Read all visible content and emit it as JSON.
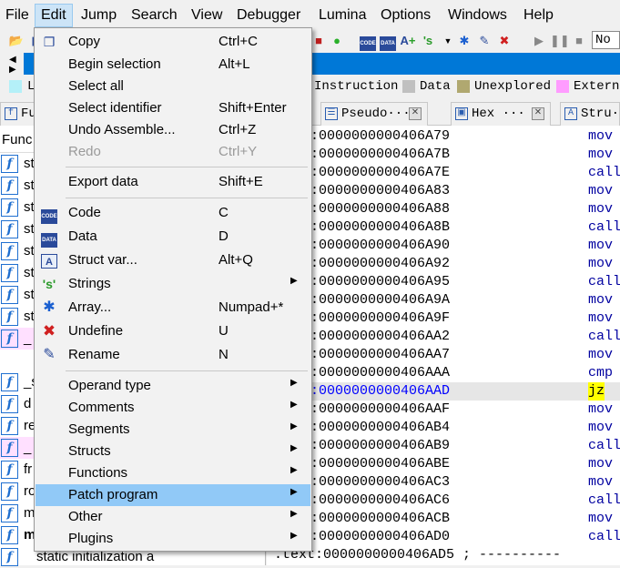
{
  "menubar": [
    "File",
    "Edit",
    "Jump",
    "Search",
    "View",
    "Debugger",
    "Lumina",
    "Options",
    "Windows",
    "Help"
  ],
  "toolbar": {
    "combo_value": "No"
  },
  "legend": [
    {
      "label": "L",
      "color": "#b4f0f8"
    },
    {
      "label": "Instruction",
      "color": "#c0c0c0"
    },
    {
      "label": "Data",
      "color": "#c0c0c0"
    },
    {
      "label": "Unexplored",
      "color": "#b0a870"
    },
    {
      "label": "Extern",
      "color": "#ff9cff"
    }
  ],
  "tabs": {
    "functions": "Fu",
    "pseudo": "Pseudo···",
    "hex": "Hex ···",
    "structures": "Stru·"
  },
  "funcpanel": {
    "header": "Func",
    "rows": [
      "st",
      "st",
      "st",
      "st",
      "st",
      "st",
      "st",
      "st",
      "_",
      "_s",
      "d",
      "re",
      "_",
      "fr",
      "ro",
      "m",
      "m",
      "static initialization a"
    ]
  },
  "disasm": {
    "rows": [
      {
        "addr": ":0000000000406A79",
        "mn": "mov"
      },
      {
        "addr": ":0000000000406A7B",
        "mn": "mov"
      },
      {
        "addr": ":0000000000406A7E",
        "mn": "call"
      },
      {
        "addr": ":0000000000406A83",
        "mn": "mov"
      },
      {
        "addr": ":0000000000406A88",
        "mn": "mov"
      },
      {
        "addr": ":0000000000406A8B",
        "mn": "call"
      },
      {
        "addr": ":0000000000406A90",
        "mn": "mov"
      },
      {
        "addr": ":0000000000406A92",
        "mn": "mov"
      },
      {
        "addr": ":0000000000406A95",
        "mn": "call"
      },
      {
        "addr": ":0000000000406A9A",
        "mn": "mov"
      },
      {
        "addr": ":0000000000406A9F",
        "mn": "mov"
      },
      {
        "addr": ":0000000000406AA2",
        "mn": "call"
      },
      {
        "addr": ":0000000000406AA7",
        "mn": "mov"
      },
      {
        "addr": ":0000000000406AAA",
        "mn": "cmp"
      },
      {
        "addr": ":0000000000406AAD",
        "mn": "jz"
      },
      {
        "addr": ":0000000000406AAF",
        "mn": "mov"
      },
      {
        "addr": ":0000000000406AB4",
        "mn": "mov"
      },
      {
        "addr": ":0000000000406AB9",
        "mn": "call"
      },
      {
        "addr": ":0000000000406ABE",
        "mn": "mov"
      },
      {
        "addr": ":0000000000406AC3",
        "mn": "mov"
      },
      {
        "addr": ":0000000000406AC6",
        "mn": "call"
      },
      {
        "addr": ":0000000000406ACB",
        "mn": "mov"
      },
      {
        "addr": ":0000000000406AD0",
        "mn": "call"
      }
    ],
    "last_line": ".text:0000000000406AD5 ; ----------"
  },
  "edit_menu": {
    "items": [
      {
        "label": "Copy",
        "shortcut": "Ctrl+C"
      },
      {
        "label": "Begin selection",
        "shortcut": "Alt+L"
      },
      {
        "label": "Select all",
        "shortcut": ""
      },
      {
        "label": "Select identifier",
        "shortcut": "Shift+Enter"
      },
      {
        "label": "Undo Assemble...",
        "shortcut": "Ctrl+Z"
      },
      {
        "label": "Redo",
        "shortcut": "Ctrl+Y"
      },
      {
        "label": "Export data",
        "shortcut": "Shift+E"
      },
      {
        "label": "Code",
        "shortcut": "C"
      },
      {
        "label": "Data",
        "shortcut": "D"
      },
      {
        "label": "Struct var...",
        "shortcut": "Alt+Q"
      },
      {
        "label": "Strings",
        "shortcut": ""
      },
      {
        "label": "Array...",
        "shortcut": "Numpad+*"
      },
      {
        "label": "Undefine",
        "shortcut": "U"
      },
      {
        "label": "Rename",
        "shortcut": "N"
      },
      {
        "label": "Operand type",
        "shortcut": ""
      },
      {
        "label": "Comments",
        "shortcut": ""
      },
      {
        "label": "Segments",
        "shortcut": ""
      },
      {
        "label": "Structs",
        "shortcut": ""
      },
      {
        "label": "Functions",
        "shortcut": ""
      },
      {
        "label": "Patch program",
        "shortcut": ""
      },
      {
        "label": "Other",
        "shortcut": ""
      },
      {
        "label": "Plugins",
        "shortcut": ""
      }
    ],
    "icon_labels": {
      "code": "CODE",
      "data": "DATA",
      "struct": "A"
    }
  }
}
